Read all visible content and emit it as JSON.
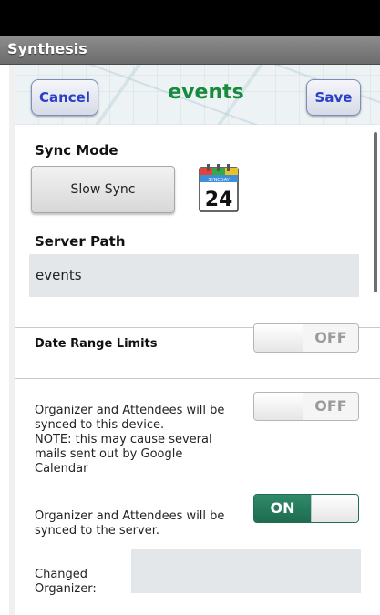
{
  "app": {
    "title": "Synthesis"
  },
  "header": {
    "cancel_label": "Cancel",
    "title": "events",
    "save_label": "Save",
    "title_color": "#168b3b"
  },
  "sync_mode": {
    "label": "Sync Mode",
    "button_label": "Slow Sync",
    "calendar_icon": {
      "name": "syncday-calendar-icon",
      "banner_text": "SYNCDAY",
      "day": "24"
    }
  },
  "server_path": {
    "label": "Server Path",
    "value": "events"
  },
  "date_range": {
    "label": "Date Range Limits",
    "toggle_state": "OFF"
  },
  "organizer_device": {
    "text_lines": [
      "Organizer and Attendees will be",
      "synced to this device.",
      "NOTE: this may cause several",
      "mails sent out by Google",
      "Calendar"
    ],
    "toggle_state": "OFF"
  },
  "organizer_server": {
    "text_lines": [
      "Organizer and Attendees will be",
      "synced to the server."
    ],
    "toggle_state": "ON"
  },
  "changed_organizer": {
    "label_lines": [
      "Changed",
      "Organizer:"
    ],
    "value": ""
  },
  "colors": {
    "button_text": "#2b3fc8",
    "toggle_on": "#1f6b50",
    "field_bg": "#e3e7ea"
  }
}
